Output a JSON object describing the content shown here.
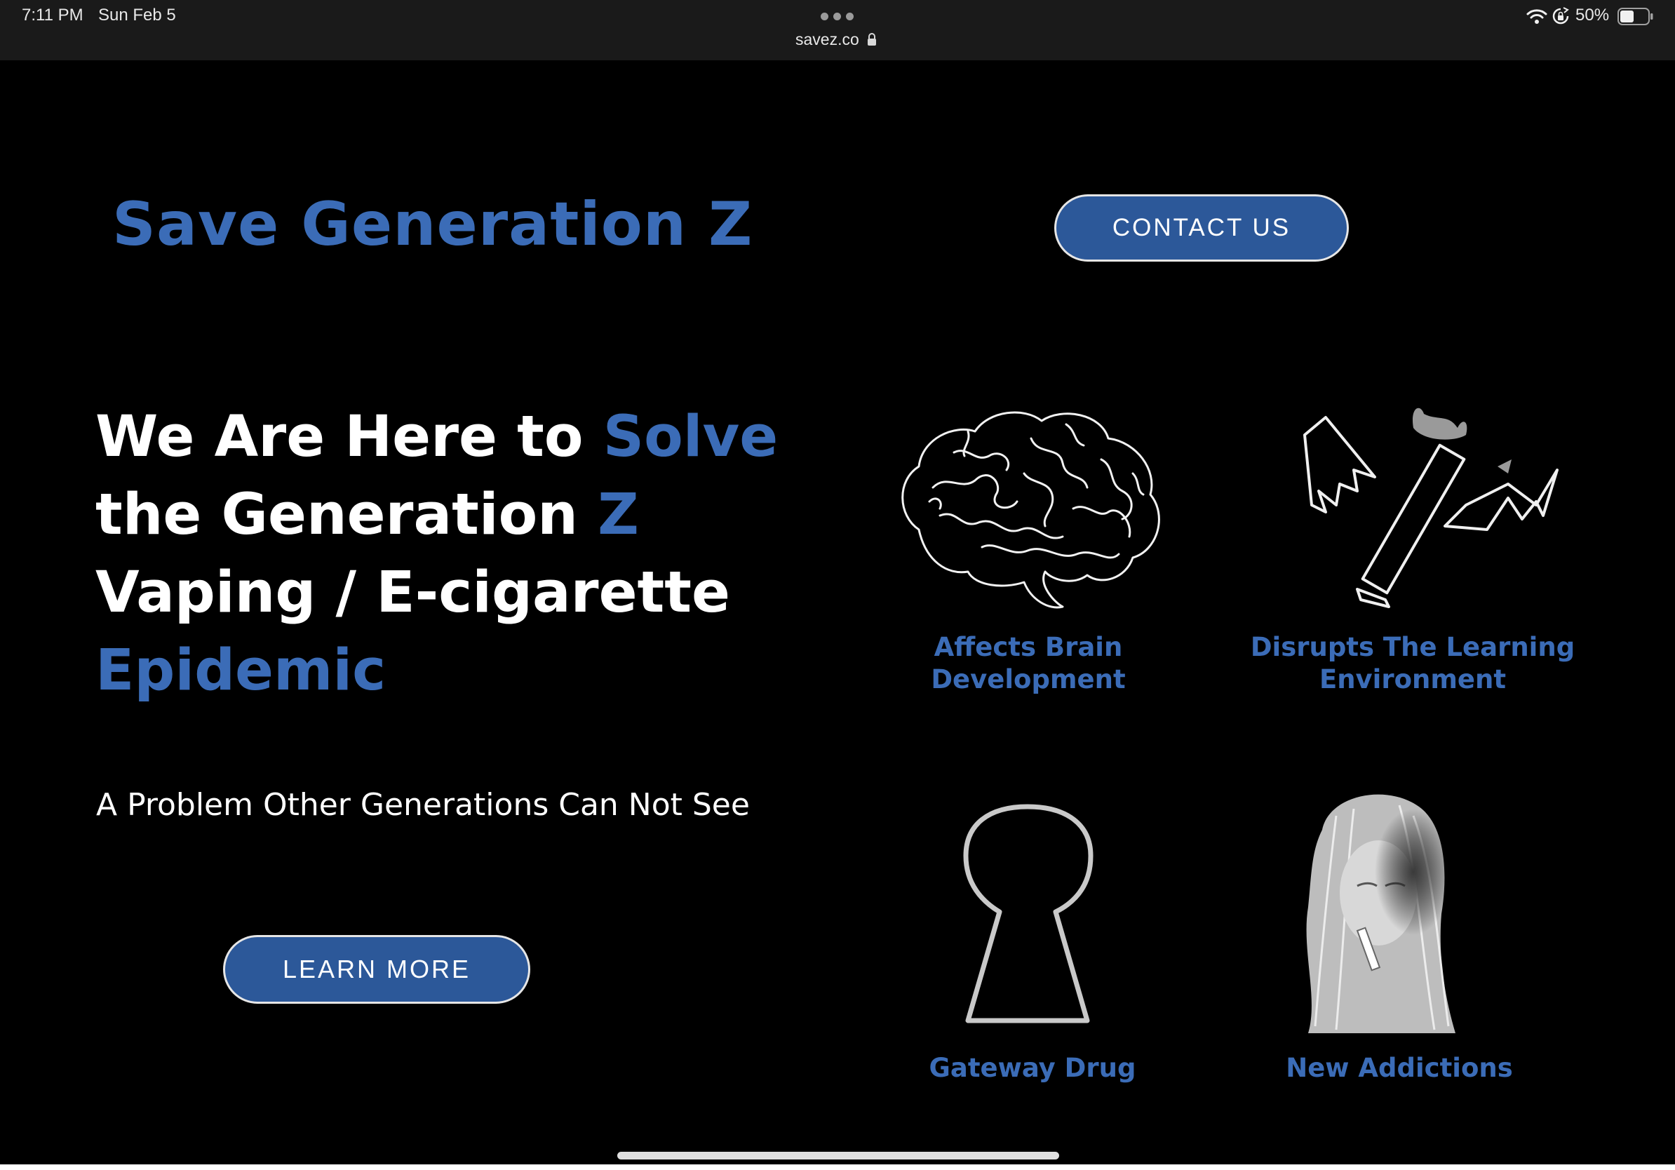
{
  "status_bar": {
    "time": "7:11 PM",
    "date": "Sun Feb 5",
    "url": "savez.co",
    "battery_percent": "50%",
    "icons": [
      "more-dots-icon",
      "lock-icon",
      "wifi-icon",
      "rotation-lock-icon",
      "battery-icon"
    ]
  },
  "header": {
    "site_title": "Save Generation Z",
    "contact_label": "CONTACT US"
  },
  "hero": {
    "line1_white": "We Are Here to ",
    "line1_blue": "Solve",
    "line2_white": "the Generation ",
    "line2_blue": "Z",
    "line3_white": "Vaping / E-cigarette",
    "line4_blue": "Epidemic",
    "subheading": "A Problem Other Generations Can Not See",
    "learn_more_label": "LEARN MORE"
  },
  "features": [
    {
      "label_line1": "Affects Brain",
      "label_line2": "Development",
      "image": "brain-illustration"
    },
    {
      "label_line1": "Disrupts The Learning",
      "label_line2": "Environment",
      "image": "winged-vape-illustration"
    },
    {
      "label_line1": "Gateway Drug",
      "image": "keyhole-illustration"
    },
    {
      "label_line1": "New Addictions",
      "image": "vaping-girl-illustration"
    }
  ],
  "colors": {
    "background": "#000000",
    "accent": "#3b6cb7",
    "button": "#2c5899",
    "text": "#ffffff"
  }
}
